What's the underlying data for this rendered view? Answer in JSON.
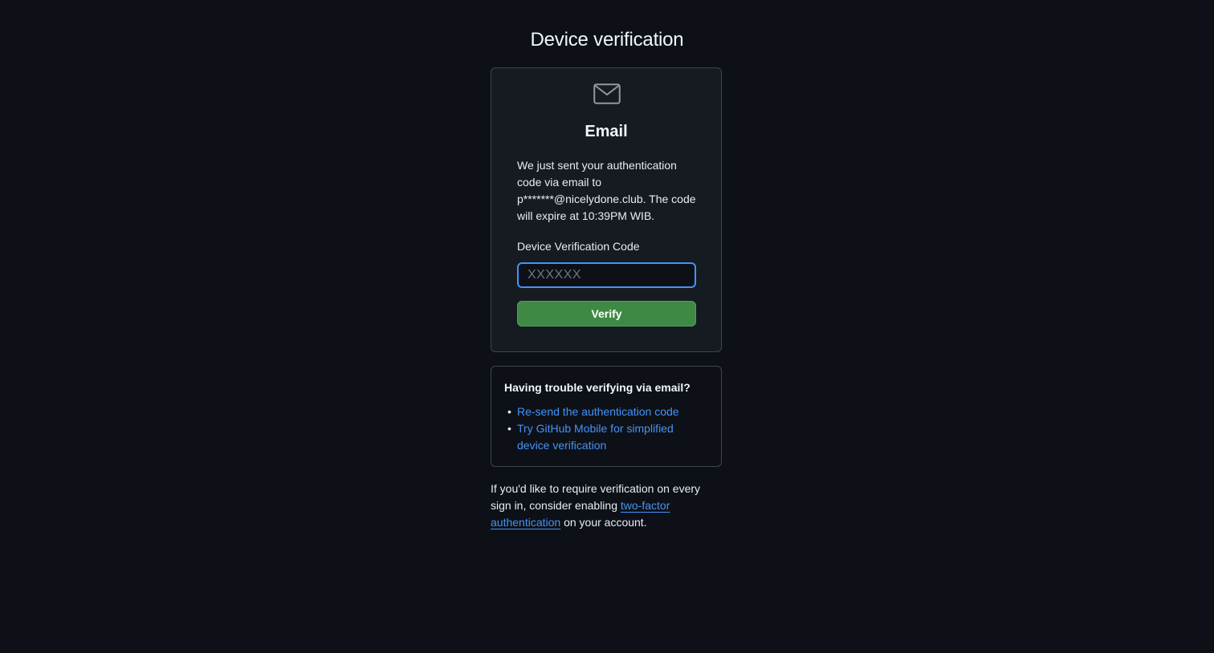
{
  "page": {
    "title": "Device verification"
  },
  "verification": {
    "icon": "mail-icon",
    "method_title": "Email",
    "message": "We just sent your authentication code via email to p*******@nicelydone.club. The code will expire at 10:39PM WIB.",
    "code_label": "Device Verification Code",
    "code_value": "",
    "code_placeholder": "XXXXXX",
    "verify_label": "Verify"
  },
  "trouble": {
    "heading": "Having trouble verifying via email?",
    "resend_link": "Re-send the authentication code",
    "mobile_link": "Try GitHub Mobile for simplified device verification"
  },
  "footer": {
    "text_before": "If you'd like to require verification on every sign in, consider enabling ",
    "link_text": "two-factor authentication",
    "text_after": " on your account."
  },
  "colors": {
    "background": "#0d1117",
    "card": "#161b22",
    "border": "#3d444d",
    "link": "#4493f8",
    "button": "#3e8a44",
    "focus": "#4493f8"
  }
}
